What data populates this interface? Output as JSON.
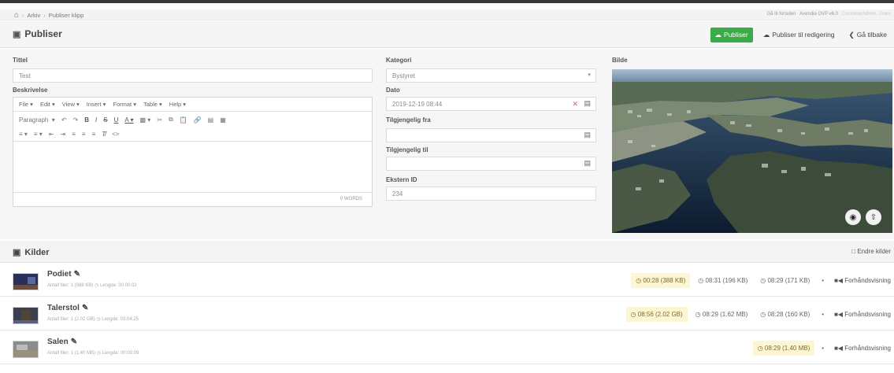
{
  "breadcrumb": {
    "items": [
      "Arkiv",
      "Publiser klipp"
    ]
  },
  "header_meta": {
    "home_link": "Gå til forsiden",
    "app_version": "Avendia OVP v6.0",
    "user": "CustomerAdmin, Users"
  },
  "page": {
    "title": "Publiser"
  },
  "actions": {
    "publish": "Publiser",
    "publish_edit": "Publiser til redigering",
    "back": "Gå tilbake"
  },
  "form": {
    "title_label": "Tittel",
    "title_value": "Test",
    "description_label": "Beskrivelse",
    "category_label": "Kategori",
    "category_value": "Bystyret",
    "date_label": "Dato",
    "date_value": "2019-12-19 08:44",
    "available_from_label": "Tilgjengelig fra",
    "available_from_value": "",
    "available_to_label": "Tilgjengelig til",
    "available_to_value": "",
    "external_id_label": "Ekstern ID",
    "external_id_value": "234",
    "image_label": "Bilde"
  },
  "editor": {
    "menu": [
      "File",
      "Edit",
      "View",
      "Insert",
      "Format",
      "Table",
      "Help"
    ],
    "block_format": "Paragraph",
    "word_count": "0 WORDS"
  },
  "sources": {
    "title": "Kilder",
    "edit_label": "Endre kilder",
    "preview_label": "Forhåndsvisning",
    "rows": [
      {
        "name": "Podiet",
        "files": "Antall filer: 1 (388 KB)",
        "length": "Lengde: 00:00:02",
        "variants": [
          {
            "label": "00:28 (388 KB)",
            "highlight": true
          },
          {
            "label": "08:31 (196 KB)",
            "highlight": false
          },
          {
            "label": "08:29 (171 KB)",
            "highlight": false
          }
        ]
      },
      {
        "name": "Talerstol",
        "files": "Antall filer: 1 (2.02 GB)",
        "length": "Lengde: 03:04:25",
        "variants": [
          {
            "label": "08:56 (2.02 GB)",
            "highlight": true
          },
          {
            "label": "08:29 (1.62 MB)",
            "highlight": false
          },
          {
            "label": "08:28 (160 KB)",
            "highlight": false
          }
        ]
      },
      {
        "name": "Salen",
        "files": "Antall filer: 1 (1.40 MB)",
        "length": "Lengde: 00:00:09",
        "variants": [
          {
            "label": "08:29 (1.40 MB)",
            "highlight": true
          }
        ]
      }
    ]
  }
}
